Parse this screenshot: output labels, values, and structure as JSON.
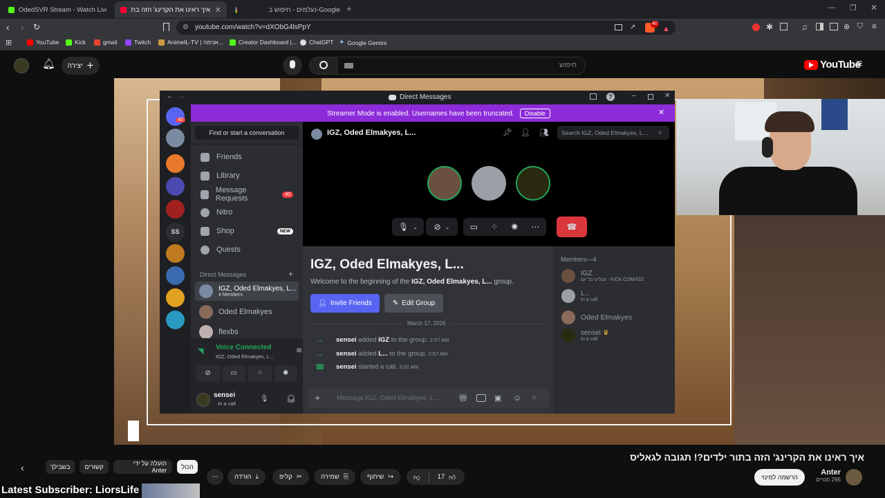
{
  "browser": {
    "tabs": [
      {
        "title": "OdedSVR Stream - Watch Live on Kic",
        "active": false
      },
      {
        "title": "איך ראינו את הקרינג' הזה בתור",
        "active": true
      },
      {
        "title": "נעלמים - חיפוש ב-Google",
        "active": false
      }
    ],
    "url": "youtube.com/watch?v=dXObG4lsPpY",
    "bookmarks": [
      "YouTube",
      "Kick",
      "gmail",
      "Twitch",
      "AnimeIL-TV | אנימה...",
      "Creator Dashboard |...",
      "ChatGPT",
      "Google Gemini"
    ],
    "badge": "40"
  },
  "youtube": {
    "create_label": "יצירה",
    "search_placeholder": "חיפוש",
    "brand": "YouTube",
    "video_title": "איך ראינו את הקרינג' הזה בתור ילדים?! תגובה לגאליס",
    "channel_name": "Anter",
    "subscribers": "295 מנויים",
    "subscribe_label": "הרשמה למינוי",
    "likes": "17",
    "share_label": "שיתוף",
    "save_label": "שמירה",
    "clip_label": "קליפ",
    "download_label": "הורדה",
    "chips": [
      "הכול",
      "הועלה על ידי Anter",
      "קשורים",
      "בשבילך"
    ],
    "ticker": "Latest Subscriber: LiorsLife"
  },
  "discord": {
    "window_title": "Direct Messages",
    "banner_text": "Streamer Mode is enabled. Usernames have been truncated.",
    "banner_button": "Disable",
    "find_placeholder": "Find or start a conversation",
    "nav": [
      "Friends",
      "Library",
      "Message Requests",
      "Nitro",
      "Shop",
      "Quests"
    ],
    "requests_badge": "40",
    "shop_badge": "NEW",
    "guild_badge": "40",
    "guild_text": "SS",
    "dm_header": "Direct Messages",
    "dms": [
      {
        "name": "IGZ, Oded Elmakyes, L...",
        "sub": "4 Members"
      },
      {
        "name": "Oded Elmakyes",
        "sub": ""
      },
      {
        "name": "flexbs",
        "sub": ""
      }
    ],
    "voice": {
      "status": "Voice Connected",
      "channel": "IGZ, Oded Elmakyes, L..."
    },
    "user": {
      "name": "sensei",
      "status": "In a call"
    },
    "call_title": "IGZ, Oded Elmakyes, L...",
    "search_placeholder": "Search IGZ, Oded Elmakyes, L...",
    "group_title": "IGZ, Oded Elmakyes, L...",
    "welcome_prefix": "Welcome to the beginning of the ",
    "welcome_bold": "IGZ, Oded Elmakyes, L...",
    "welcome_suffix": " group.",
    "invite_label": "Invite Friends",
    "edit_label": "Edit Group",
    "date": "March 17, 2026",
    "messages": [
      {
        "actor": "sensei",
        "action": "added",
        "target": "IGZ",
        "rest": "to the group.",
        "time": "2:57 AM"
      },
      {
        "actor": "sensei",
        "action": "added",
        "target": "L...",
        "rest": "to the group.",
        "time": "2:57 AM"
      },
      {
        "actor": "sensei",
        "action": "started a call.",
        "target": "",
        "rest": "",
        "time": "3:02 AM"
      }
    ],
    "message_placeholder": "Message IGZ, Oded Elmakyes, L...",
    "members_header": "Members—4",
    "members": [
      {
        "name": "IGZ",
        "sub": "גבליט כל יום - KICK.COM/IGZ"
      },
      {
        "name": "L...",
        "sub": "In a call"
      },
      {
        "name": "Oded Elmakyes",
        "sub": ""
      },
      {
        "name": "sensei",
        "sub": "In a call"
      }
    ]
  }
}
